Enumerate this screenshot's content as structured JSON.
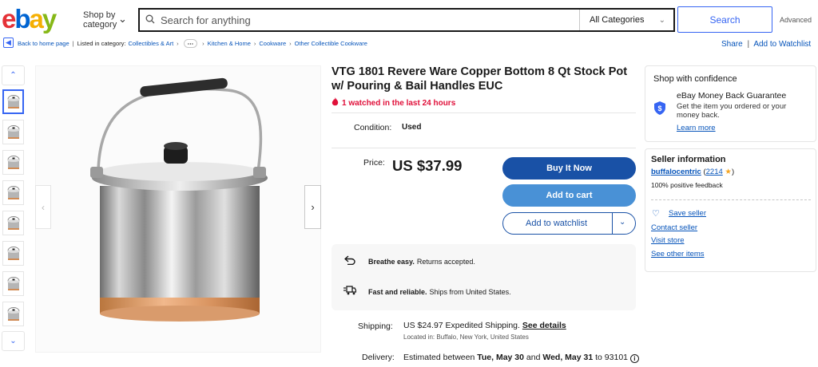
{
  "header": {
    "logo_letters": [
      "e",
      "b",
      "a",
      "y"
    ],
    "logo_colors": [
      "#e53238",
      "#0064d2",
      "#f5af02",
      "#86b817"
    ],
    "shop_by_category": "Shop by category",
    "search_placeholder": "Search for anything",
    "category_select": "All Categories",
    "search_button": "Search",
    "advanced_link": "Advanced"
  },
  "breadcrumb": {
    "back": "Back to home page",
    "listed_in": "Listed in category:",
    "items": [
      "Collectibles & Art",
      "Kitchen & Home",
      "Cookware",
      "Other Collectible Cookware"
    ],
    "share": "Share",
    "add_to_watchlist": "Add to Watchlist"
  },
  "gallery": {
    "thumbnail_count": 8,
    "selected_index": 0,
    "main_image_icon": "stock-pot-photo"
  },
  "listing": {
    "title": "VTG 1801 Revere Ware Copper Bottom 8 Qt Stock Pot w/ Pouring & Bail Handles EUC",
    "watched": "1 watched in the last 24 hours",
    "condition_label": "Condition:",
    "condition_value": "Used",
    "price_label": "Price:",
    "price_value": "US $37.99",
    "buy_now": "Buy It Now",
    "add_to_cart": "Add to cart",
    "add_to_watchlist": "Add to watchlist",
    "returns_bold": "Breathe easy.",
    "returns_text": "Returns accepted.",
    "shipping_bold": "Fast and reliable.",
    "shipping_text": "Ships from United States.",
    "shipping_label": "Shipping:",
    "shipping_value": "US $24.97 Expedited Shipping.",
    "see_details": "See details",
    "located_in": "Located in: Buffalo, New York, United States",
    "delivery_label": "Delivery:",
    "delivery_prefix": "Estimated between",
    "delivery_date1": "Tue, May 30",
    "delivery_and": "and",
    "delivery_date2": "Wed, May 31",
    "delivery_suffix": "to 93101"
  },
  "confidence": {
    "title": "Shop with confidence",
    "guarantee": "eBay Money Back Guarantee",
    "description": "Get the item you ordered or your money back.",
    "learn_more": "Learn more"
  },
  "seller": {
    "title": "Seller information",
    "name": "buffalocentric",
    "score": "2214",
    "feedback": "100% positive feedback",
    "save_seller": "Save seller",
    "contact_seller": "Contact seller",
    "visit_store": "Visit store",
    "see_other_items": "See other items"
  },
  "colors": {
    "primary_blue": "#3665f3",
    "buy_now_bg": "#1951a6",
    "add_cart_bg": "#4991d6",
    "watched_red": "#e0103a"
  }
}
